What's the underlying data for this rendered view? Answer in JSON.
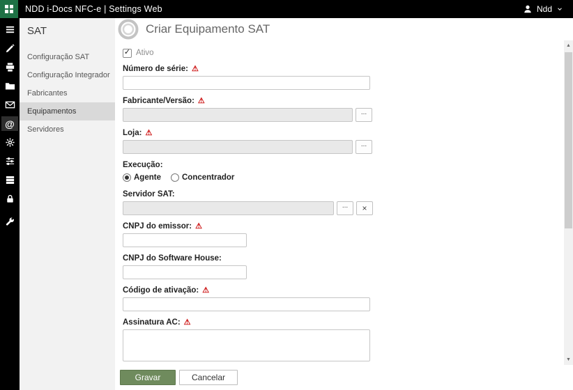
{
  "topbar": {
    "title": "NDD i-Docs NFC-e | Settings Web",
    "user_name": "Ndd"
  },
  "sidebar_icons": [
    "menu",
    "tools",
    "printer",
    "folder",
    "mail",
    "at",
    "gear",
    "sliders",
    "server",
    "lock",
    "wrench"
  ],
  "nav": {
    "title": "SAT",
    "items": [
      {
        "label": "Configuração SAT",
        "selected": false
      },
      {
        "label": "Configuração Integrador",
        "selected": false
      },
      {
        "label": "Fabricantes",
        "selected": false
      },
      {
        "label": "Equipamentos",
        "selected": true
      },
      {
        "label": "Servidores",
        "selected": false
      }
    ]
  },
  "main": {
    "title": "Criar Equipamento SAT",
    "form": {
      "ativo": {
        "label": "Ativo",
        "checked": true
      },
      "numero_serie": {
        "label": "Número de série:",
        "required": true,
        "value": ""
      },
      "fabricante_versao": {
        "label": "Fabricante/Versão:",
        "required": true,
        "value": "",
        "browse_label": "..."
      },
      "loja": {
        "label": "Loja:",
        "required": true,
        "value": "",
        "browse_label": "..."
      },
      "execucao": {
        "label": "Execução:",
        "options": [
          "Agente",
          "Concentrador"
        ],
        "selected": "Agente"
      },
      "servidor_sat": {
        "label": "Servidor SAT:",
        "required": false,
        "value": "",
        "browse_label": "...",
        "clear_label": "×"
      },
      "cnpj_emissor": {
        "label": "CNPJ do emissor:",
        "required": true,
        "value": ""
      },
      "cnpj_software_house": {
        "label": "CNPJ do Software House:",
        "required": false,
        "value": ""
      },
      "codigo_ativacao": {
        "label": "Código de ativação:",
        "required": true,
        "value": ""
      },
      "assinatura_ac": {
        "label": "Assinatura AC:",
        "required": true,
        "value": ""
      }
    },
    "footer": {
      "save_label": "Gravar",
      "cancel_label": "Cancelar"
    }
  },
  "glyphs": {
    "check": "✓",
    "warning": "⚠",
    "scroll_up": "▲",
    "scroll_down": "▼"
  },
  "colors": {
    "topbar_bg": "#000000",
    "launcher_tile_bg": "#1e7145",
    "save_button": "#6f8b5d",
    "required_warning": "#cc1111",
    "selected_nav_bg": "#d9d9d9"
  }
}
